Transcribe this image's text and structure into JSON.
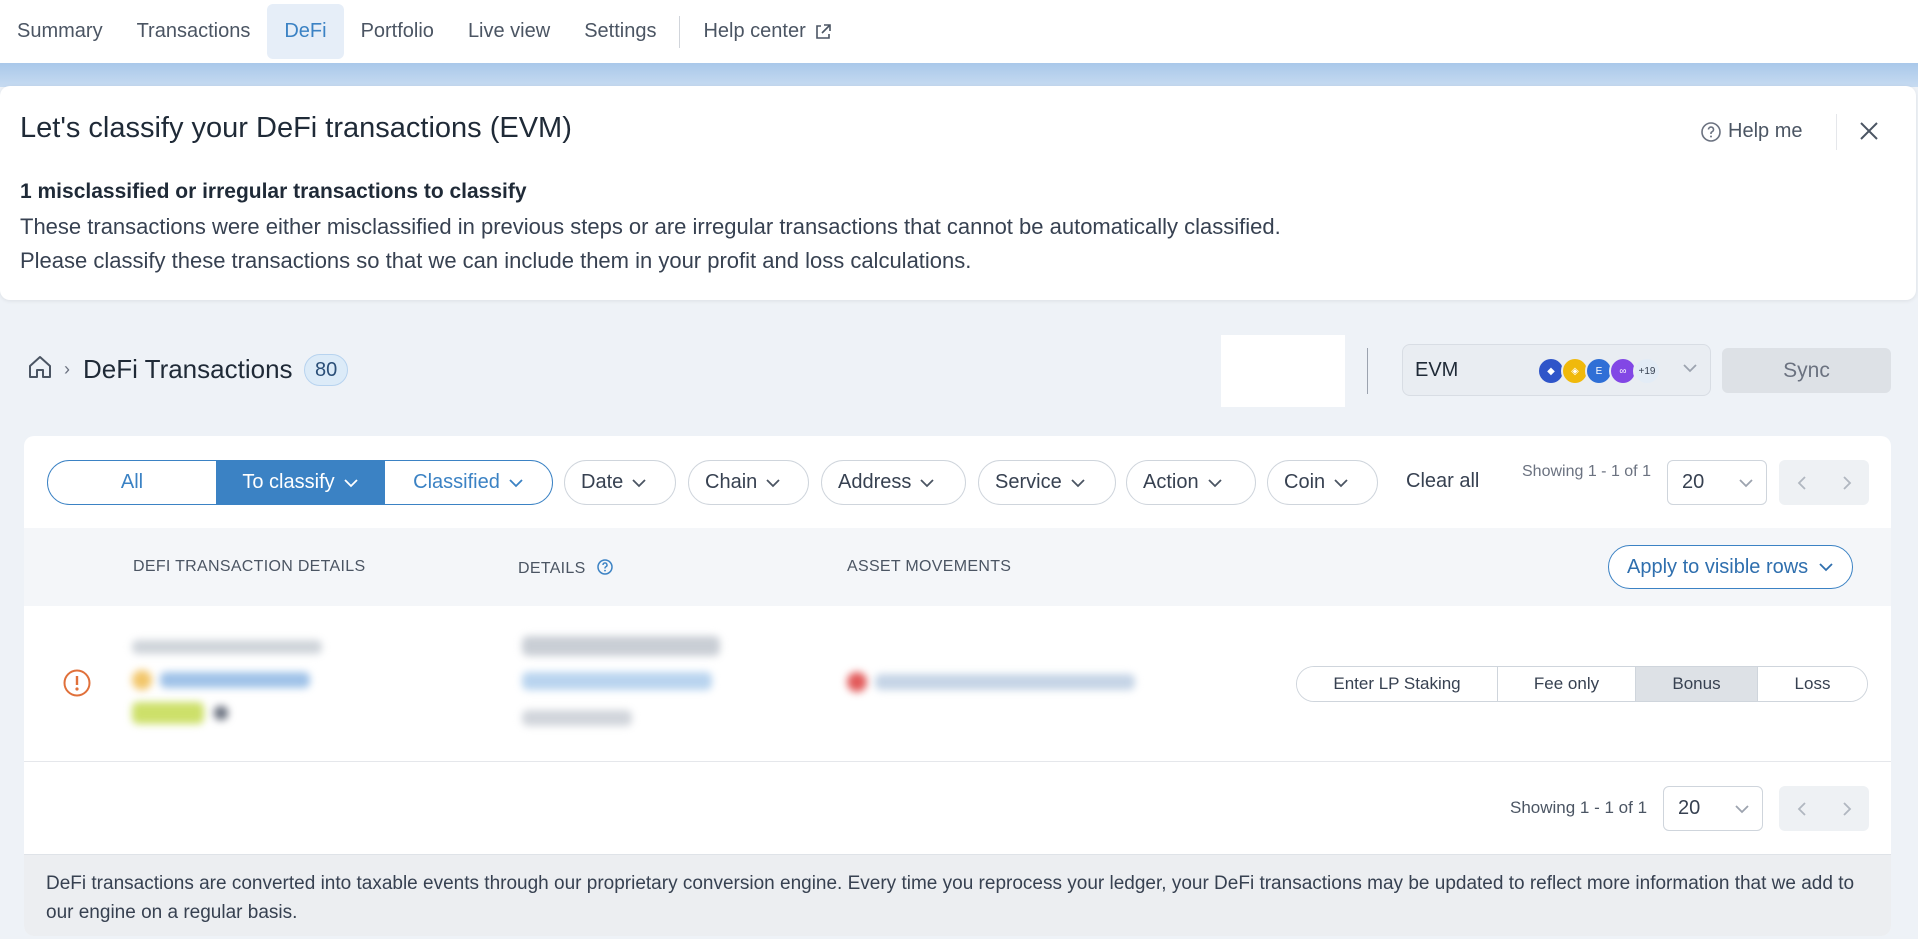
{
  "nav": {
    "items": [
      {
        "label": "Summary",
        "active": false
      },
      {
        "label": "Transactions",
        "active": false
      },
      {
        "label": "DeFi",
        "active": true
      },
      {
        "label": "Portfolio",
        "active": false
      },
      {
        "label": "Live view",
        "active": false
      },
      {
        "label": "Settings",
        "active": false
      }
    ],
    "help_center": "Help center"
  },
  "banner": {
    "title": "Let's classify your DeFi transactions (EVM)",
    "help_me": "Help me",
    "subtitle": "1 misclassified or irregular transactions to classify",
    "line1": "These transactions were either misclassified in previous steps or are irregular transactions that cannot be automatically classified.",
    "line2": "Please classify these transactions so that we can include them in your profit and loss calculations."
  },
  "breadcrumb": {
    "title": "DeFi Transactions",
    "count": "80"
  },
  "chain_selector": {
    "label": "EVM",
    "more_count": "+19",
    "icons": [
      "ethereum-icon",
      "bnb-icon",
      "chain-e-icon",
      "polygon-icon"
    ]
  },
  "sync_label": "Sync",
  "tabs": {
    "all": "All",
    "to_classify": "To classify",
    "classified": "Classified"
  },
  "filters": {
    "date": "Date",
    "chain": "Chain",
    "address": "Address",
    "service": "Service",
    "action": "Action",
    "coin": "Coin",
    "clear_all": "Clear all"
  },
  "pagination": {
    "showing_top": "Showing 1 - 1 of 1",
    "page_size": "20",
    "showing_bottom": "Showing 1 - 1 of 1"
  },
  "table": {
    "col_details_title": "DEFI TRANSACTION DETAILS",
    "col_details": "DETAILS",
    "col_assets": "ASSET MOVEMENTS",
    "apply_label": "Apply to visible rows"
  },
  "row_actions": [
    "Enter LP Staking",
    "Fee only",
    "Bonus",
    "Loss"
  ],
  "row_selected_action": "Bonus",
  "colors": {
    "accent": "#3b82c4",
    "warning": "#e0703a"
  },
  "footnote": "DeFi transactions are converted into taxable events through our proprietary conversion engine. Every time you reprocess your ledger, your DeFi transactions may be updated to reflect more information that we add to our engine on a regular basis."
}
